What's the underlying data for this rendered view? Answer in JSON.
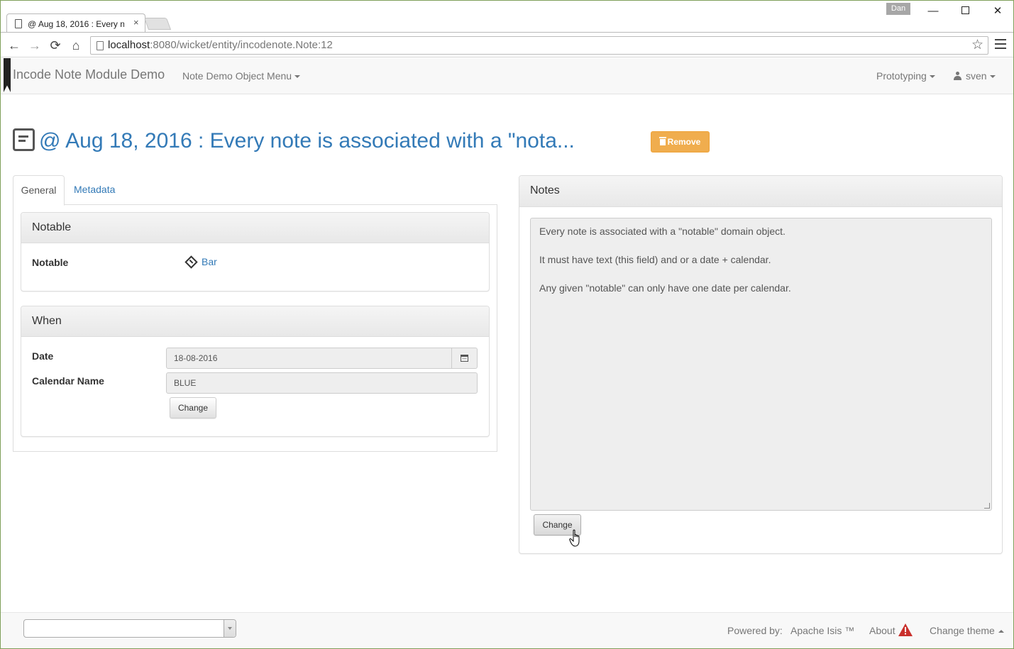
{
  "browser": {
    "tab_title": "@ Aug 18, 2016 : Every no",
    "tab_close": "×",
    "user_badge": "Dan",
    "url_host": "localhost",
    "url_rest": ":8080/wicket/entity/incodenote.Note:12",
    "win_min": "—",
    "win_close": "✕",
    "nav_back": "←",
    "nav_forward": "→",
    "nav_reload": "⟳",
    "nav_home": "⌂",
    "star": "☆"
  },
  "navbar": {
    "brand": "Incode Note Module Demo",
    "object_menu": "Note Demo Object Menu",
    "prototyping": "Prototyping",
    "user": "sven"
  },
  "page": {
    "title": "@ Aug 18, 2016 : Every note is associated with a \"nota...",
    "remove_label": "Remove"
  },
  "tabs": {
    "general": "General",
    "metadata": "Metadata"
  },
  "notable_panel": {
    "heading": "Notable",
    "field_label": "Notable",
    "value": "Bar"
  },
  "when_panel": {
    "heading": "When",
    "date_label": "Date",
    "date_value": "18-08-2016",
    "calendar_label": "Calendar Name",
    "calendar_value": "BLUE",
    "change_label": "Change"
  },
  "notes_panel": {
    "heading": "Notes",
    "lines": [
      "Every note is associated with a \"notable\" domain object.",
      "It must have text (this field) and or a date + calendar.",
      "Any given \"notable\" can only have one date per calendar."
    ],
    "change_label": "Change"
  },
  "footer": {
    "powered_by": "Powered by:",
    "framework": "Apache Isis ™",
    "about": "About",
    "change_theme": "Change theme"
  },
  "colors": {
    "link": "#337ab7",
    "warning_button": "#f0ad4e",
    "warning_icon": "#c9302c"
  }
}
